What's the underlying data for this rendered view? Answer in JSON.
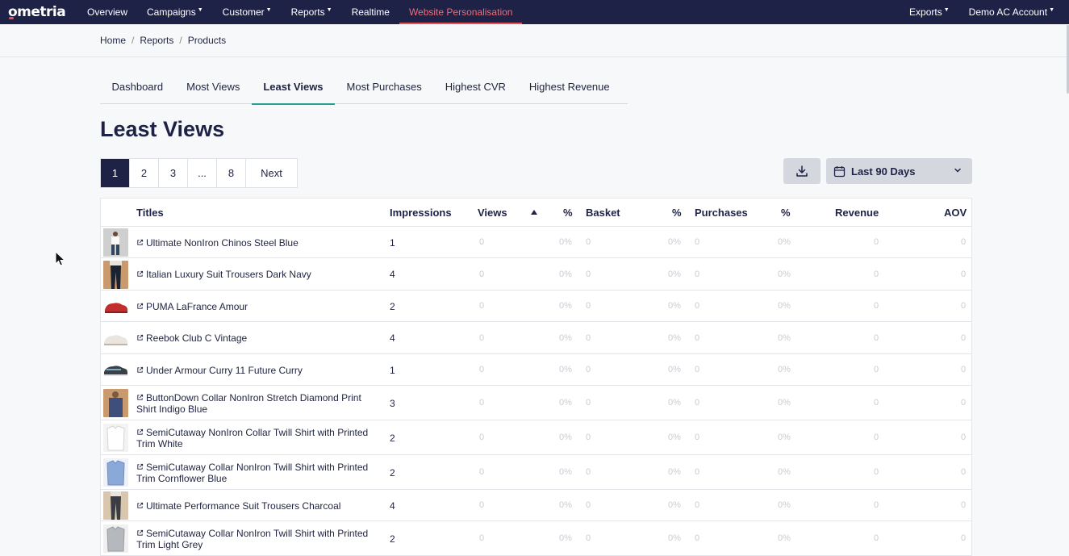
{
  "app": {
    "logo_text": "ometria"
  },
  "nav": {
    "left": [
      {
        "label": "Overview",
        "caret": false
      },
      {
        "label": "Campaigns",
        "caret": true
      },
      {
        "label": "Customer",
        "caret": true
      },
      {
        "label": "Reports",
        "caret": true
      },
      {
        "label": "Realtime",
        "caret": false
      },
      {
        "label": "Website Personalisation",
        "caret": false,
        "active": true
      }
    ],
    "right": [
      {
        "label": "Exports",
        "caret": true
      },
      {
        "label": "Demo AC Account",
        "caret": true
      }
    ],
    "caret_glyph": "▼"
  },
  "breadcrumb": {
    "items": [
      "Home",
      "Reports",
      "Products"
    ],
    "separator": "/"
  },
  "tabs": [
    {
      "label": "Dashboard"
    },
    {
      "label": "Most Views"
    },
    {
      "label": "Least Views",
      "active": true
    },
    {
      "label": "Most Purchases"
    },
    {
      "label": "Highest CVR"
    },
    {
      "label": "Highest Revenue"
    }
  ],
  "page_title": "Least Views",
  "pagination": {
    "pages": [
      "1",
      "2",
      "3",
      "...",
      "8"
    ],
    "current": "1",
    "next_label": "Next"
  },
  "toolbar": {
    "download_icon": "download-icon",
    "date_range": "Last 90 Days"
  },
  "table": {
    "columns": {
      "titles": "Titles",
      "impressions": "Impressions",
      "views": "Views",
      "views_pct": "%",
      "basket": "Basket",
      "basket_pct": "%",
      "purchases": "Purchases",
      "purchases_pct": "%",
      "revenue": "Revenue",
      "aov": "AOV"
    },
    "sorted_column": "views",
    "rows": [
      {
        "title": "Ultimate NonIron Chinos Steel Blue",
        "impressions": "1",
        "views": "0",
        "views_pct": "0%",
        "basket": "0",
        "basket_pct": "0%",
        "purchases": "0",
        "purchases_pct": "0%",
        "revenue": "0",
        "aov": "0",
        "thumb": "person"
      },
      {
        "title": "Italian Luxury Suit Trousers Dark Navy",
        "impressions": "4",
        "views": "0",
        "views_pct": "0%",
        "basket": "0",
        "basket_pct": "0%",
        "purchases": "0",
        "purchases_pct": "0%",
        "revenue": "0",
        "aov": "0",
        "thumb": "trousers"
      },
      {
        "title": "PUMA LaFrance Amour",
        "impressions": "2",
        "views": "0",
        "views_pct": "0%",
        "basket": "0",
        "basket_pct": "0%",
        "purchases": "0",
        "purchases_pct": "0%",
        "revenue": "0",
        "aov": "0",
        "thumb": "red-shoe"
      },
      {
        "title": "Reebok Club C Vintage",
        "impressions": "4",
        "views": "0",
        "views_pct": "0%",
        "basket": "0",
        "basket_pct": "0%",
        "purchases": "0",
        "purchases_pct": "0%",
        "revenue": "0",
        "aov": "0",
        "thumb": "white-shoe"
      },
      {
        "title": "Under Armour Curry 11 Future Curry",
        "impressions": "1",
        "views": "0",
        "views_pct": "0%",
        "basket": "0",
        "basket_pct": "0%",
        "purchases": "0",
        "purchases_pct": "0%",
        "revenue": "0",
        "aov": "0",
        "thumb": "dark-shoe"
      },
      {
        "title": "ButtonDown Collar NonIron Stretch Diamond Print Shirt Indigo Blue",
        "impressions": "3",
        "views": "0",
        "views_pct": "0%",
        "basket": "0",
        "basket_pct": "0%",
        "purchases": "0",
        "purchases_pct": "0%",
        "revenue": "0",
        "aov": "0",
        "thumb": "shirt-model"
      },
      {
        "title": "SemiCutaway NonIron Collar Twill Shirt with Printed Trim White",
        "impressions": "2",
        "views": "0",
        "views_pct": "0%",
        "basket": "0",
        "basket_pct": "0%",
        "purchases": "0",
        "purchases_pct": "0%",
        "revenue": "0",
        "aov": "0",
        "thumb": "white-shirt"
      },
      {
        "title": "SemiCutaway Collar NonIron Twill Shirt with Printed Trim Cornflower Blue",
        "impressions": "2",
        "views": "0",
        "views_pct": "0%",
        "basket": "0",
        "basket_pct": "0%",
        "purchases": "0",
        "purchases_pct": "0%",
        "revenue": "0",
        "aov": "0",
        "thumb": "blue-shirt"
      },
      {
        "title": "Ultimate Performance Suit Trousers Charcoal",
        "impressions": "4",
        "views": "0",
        "views_pct": "0%",
        "basket": "0",
        "basket_pct": "0%",
        "purchases": "0",
        "purchases_pct": "0%",
        "revenue": "0",
        "aov": "0",
        "thumb": "charcoal-trousers"
      },
      {
        "title": "SemiCutaway Collar NonIron Twill Shirt with Printed Trim Light Grey",
        "impressions": "2",
        "views": "0",
        "views_pct": "0%",
        "basket": "0",
        "basket_pct": "0%",
        "purchases": "0",
        "purchases_pct": "0%",
        "revenue": "0",
        "aov": "0",
        "thumb": "grey-shirt"
      }
    ]
  },
  "colors": {
    "nav_bg": "#1e2247",
    "accent_red": "#e8515a",
    "tab_underline": "#2a9d8f",
    "muted_value": "#c9ccd3"
  }
}
